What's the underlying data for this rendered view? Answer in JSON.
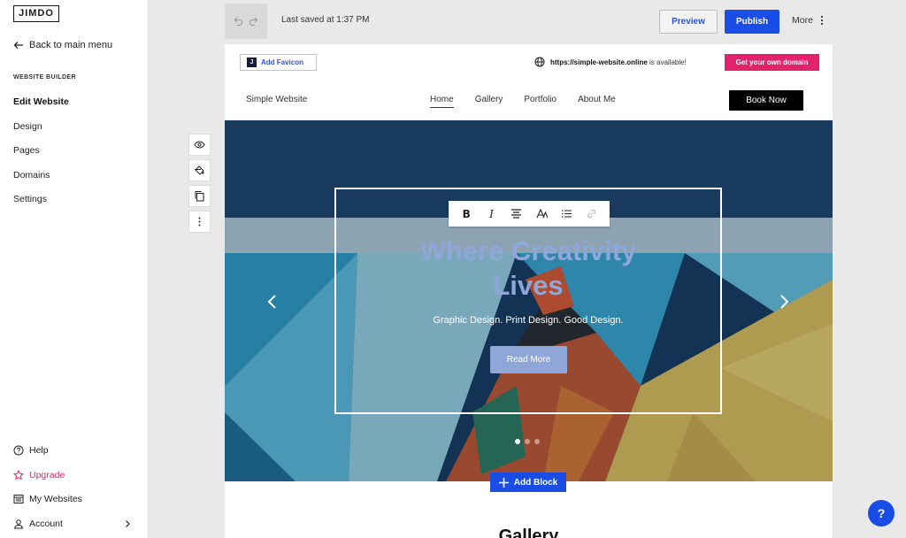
{
  "sidebar": {
    "logo": "JIMDO",
    "back_label": "Back to main menu",
    "section_heading": "WEBSITE BUILDER",
    "items": [
      {
        "label": "Edit Website",
        "active": true
      },
      {
        "label": "Design"
      },
      {
        "label": "Pages"
      },
      {
        "label": "Domains"
      },
      {
        "label": "Settings"
      }
    ],
    "bottom": [
      {
        "label": "Help",
        "icon": "help-icon"
      },
      {
        "label": "Upgrade",
        "icon": "star-icon"
      },
      {
        "label": "My Websites",
        "icon": "websites-icon"
      },
      {
        "label": "Account",
        "icon": "user-icon"
      }
    ]
  },
  "topbar": {
    "saved_text": "Last saved at 1:37 PM",
    "preview_label": "Preview",
    "publish_label": "Publish",
    "more_label": "More"
  },
  "site": {
    "favicon_label": "Add Favicon",
    "favicon_badge": "J",
    "domain_url": "https://simple-website.online",
    "domain_suffix": " is available!",
    "domain_button": "Get your own domain",
    "name": "Simple Website",
    "nav": [
      "Home",
      "Gallery",
      "Portfolio",
      "About Me"
    ],
    "book_label": "Book Now",
    "hero": {
      "title_line1": "Where Creativity",
      "title_line2": "Lives",
      "subtitle": "Graphic Design. Print Design. Good Design.",
      "button": "Read More",
      "slides": 3,
      "active_slide": 1
    },
    "format_toolbar": [
      "B",
      "I",
      "align",
      "font",
      "list",
      "link"
    ],
    "next_section_title": "Gallery"
  },
  "add_block_label": "Add Block",
  "help_fab": "?",
  "colors": {
    "accent_blue": "#1a4de6",
    "pink": "#e0236b",
    "hero_title": "#8ea6d8"
  }
}
